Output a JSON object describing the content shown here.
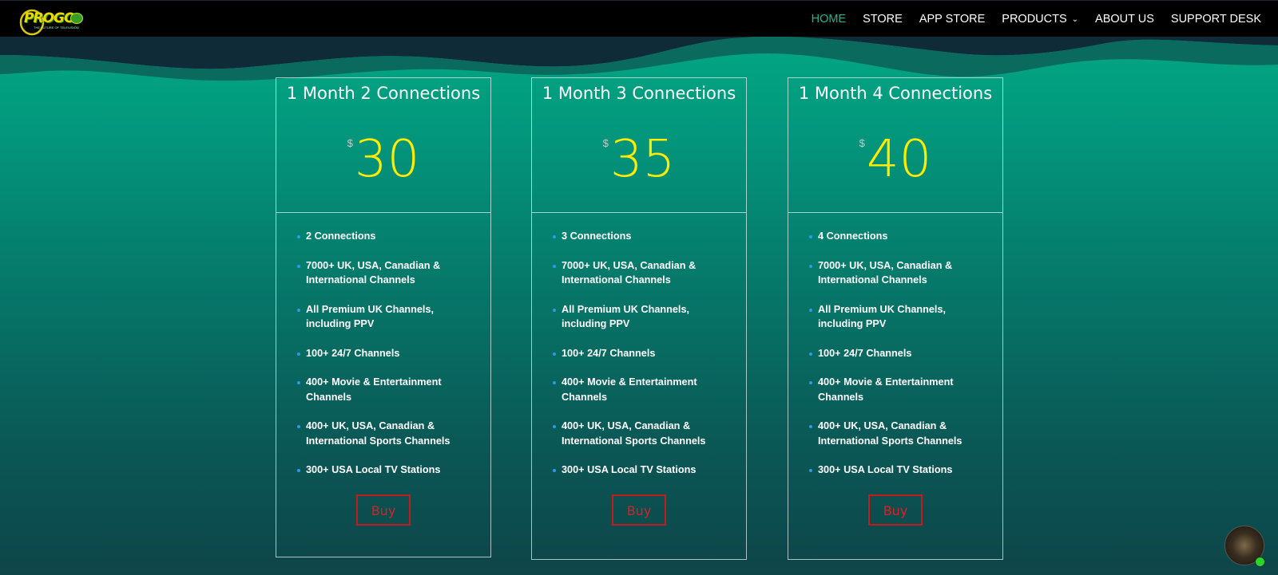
{
  "header": {
    "logo_text": "PROGO",
    "logo_tagline": "THE FUTURE OF TELEVISION",
    "nav": [
      {
        "label": "HOME",
        "active": true
      },
      {
        "label": "STORE"
      },
      {
        "label": "APP STORE"
      },
      {
        "label": "PRODUCTS",
        "has_dropdown": true
      },
      {
        "label": "ABOUT US"
      },
      {
        "label": "SUPPORT DESK"
      }
    ]
  },
  "colors": {
    "accent_teal": "#1bb597",
    "price_yellow": "#ffec00",
    "buy_red": "#c61b1b",
    "bullet_blue": "#2f9ae5"
  },
  "plans": [
    {
      "title": "1 Month 2 Connections",
      "currency": "$",
      "price": "30",
      "features": [
        "2 Connections",
        "7000+ UK, USA, Canadian & International Channels",
        "All Premium UK Channels, including PPV",
        "100+ 24/7 Channels",
        "400+ Movie & Entertainment Channels",
        "400+ UK, USA, Canadian & International Sports Channels",
        "300+ USA Local TV Stations"
      ],
      "button": "Buy"
    },
    {
      "title": "1 Month 3 Connections",
      "currency": "$",
      "price": "35",
      "features": [
        "3 Connections",
        "7000+ UK, USA, Canadian & International Channels",
        "All Premium UK Channels, including PPV",
        "100+ 24/7 Channels",
        "400+ Movie & Entertainment Channels",
        "400+ UK, USA, Canadian & International Sports Channels",
        "300+ USA Local TV Stations"
      ],
      "button": "Buy"
    },
    {
      "title": "1 Month 4 Connections",
      "currency": "$",
      "price": "40",
      "features": [
        "4 Connections",
        "7000+ UK, USA, Canadian & International Channels",
        "All Premium UK Channels, including PPV",
        "100+ 24/7 Channels",
        "400+ Movie & Entertainment Channels",
        "400+ UK, USA, Canadian & International Sports Channels",
        "300+ USA Local TV Stations"
      ],
      "button": "Buy"
    }
  ]
}
